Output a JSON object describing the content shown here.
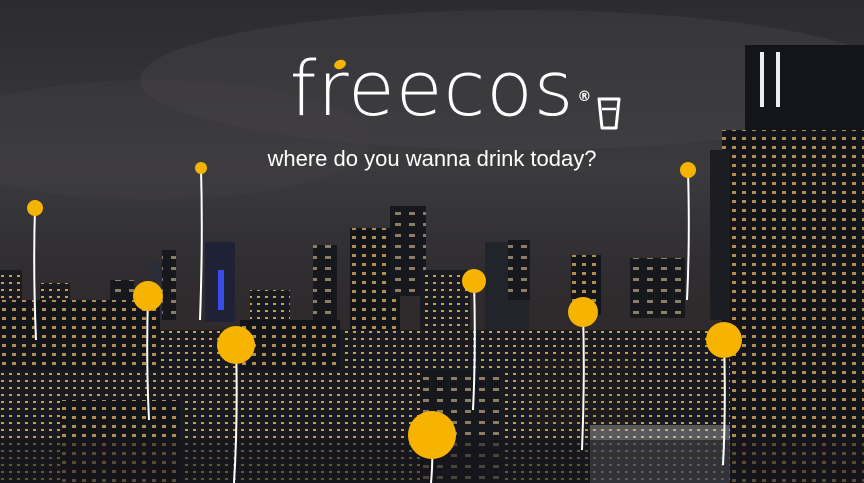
{
  "brand": {
    "name": "freecos",
    "registered": "®"
  },
  "tagline": "where do you wanna drink today?",
  "colors": {
    "accent": "#f6b400",
    "text": "#ffffff",
    "sky": "#2a2a30"
  },
  "icons": {
    "logo_glass": "glass-icon",
    "pins": "location-pin"
  },
  "map_pins": [
    {
      "id": "pin-1",
      "size": "small"
    },
    {
      "id": "pin-2",
      "size": "small"
    },
    {
      "id": "pin-3",
      "size": "small"
    },
    {
      "id": "pin-4",
      "size": "medium"
    },
    {
      "id": "pin-5",
      "size": "medium"
    },
    {
      "id": "pin-6",
      "size": "medium"
    },
    {
      "id": "pin-7",
      "size": "medium"
    },
    {
      "id": "pin-8",
      "size": "medium"
    },
    {
      "id": "pin-9",
      "size": "large"
    }
  ]
}
